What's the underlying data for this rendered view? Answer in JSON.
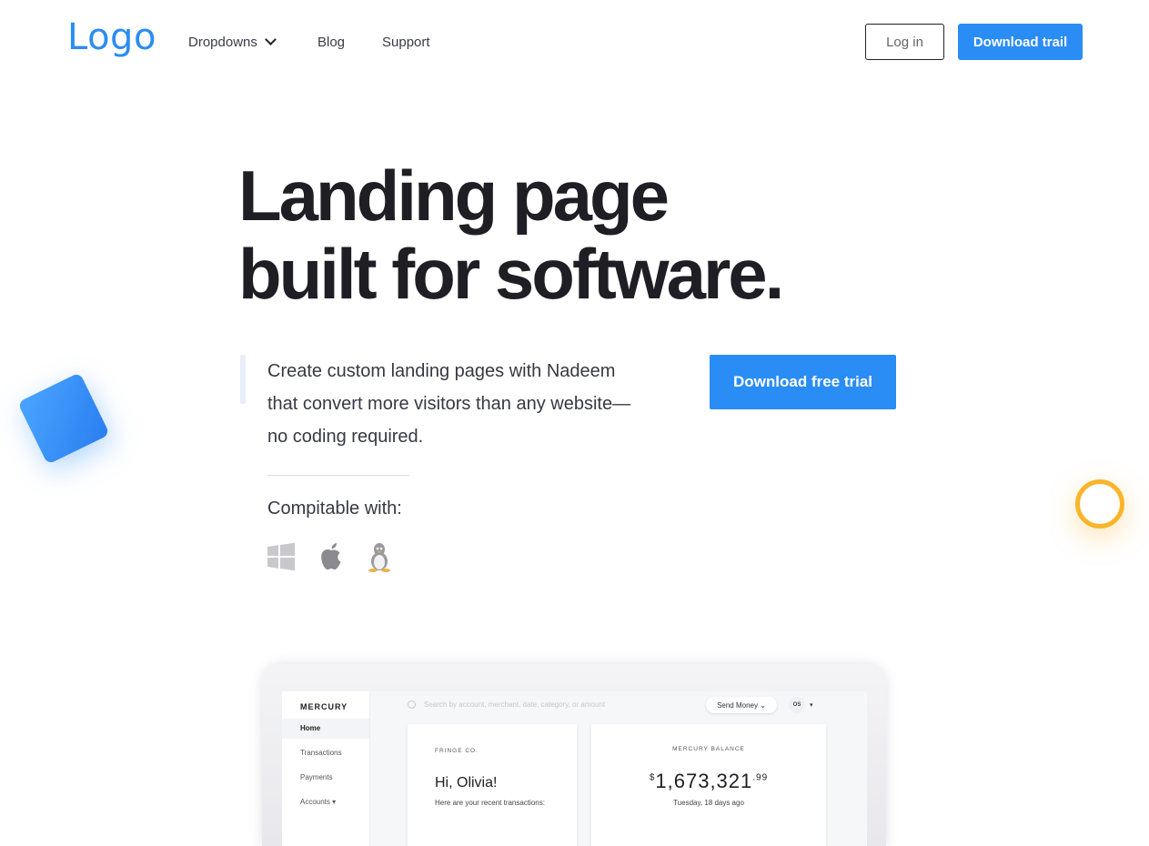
{
  "header": {
    "logo": "Logo",
    "nav": [
      {
        "label": "Dropdowns",
        "has_dropdown": true
      },
      {
        "label": "Blog",
        "has_dropdown": false
      },
      {
        "label": "Support",
        "has_dropdown": false
      }
    ],
    "login_label": "Log in",
    "cta_label": "Download trail"
  },
  "hero": {
    "title_line1": "Landing page",
    "title_line2": "built for software.",
    "description": "Create custom landing pages with Nadeem that convert more visitors than any website—no coding required.",
    "cta_label": "Download free trial",
    "compatible_label": "Compitable with:",
    "os_icons": [
      "windows-icon",
      "apple-icon",
      "linux-icon"
    ]
  },
  "mockup": {
    "brand": "MERCURY",
    "sidebar": [
      "Home",
      "Transactions",
      "Payments",
      "Accounts"
    ],
    "search_placeholder": "Search by account, merchant, date, category, or amount",
    "send_money": "Send Money",
    "avatar_initials": "OS",
    "company": "FRINGE CO.",
    "greeting": "Hi, Olivia!",
    "recent_text": "Here are your recent transactions:",
    "balance_label": "MERCURY BALANCE",
    "balance_currency": "$",
    "balance_amount": "1,673,321",
    "balance_cents": ".99",
    "balance_date": "Tuesday, 18 days ago"
  },
  "colors": {
    "accent": "#2a8cf5",
    "decor_yellow": "#f9b52a",
    "text_dark": "#1e1e24"
  }
}
